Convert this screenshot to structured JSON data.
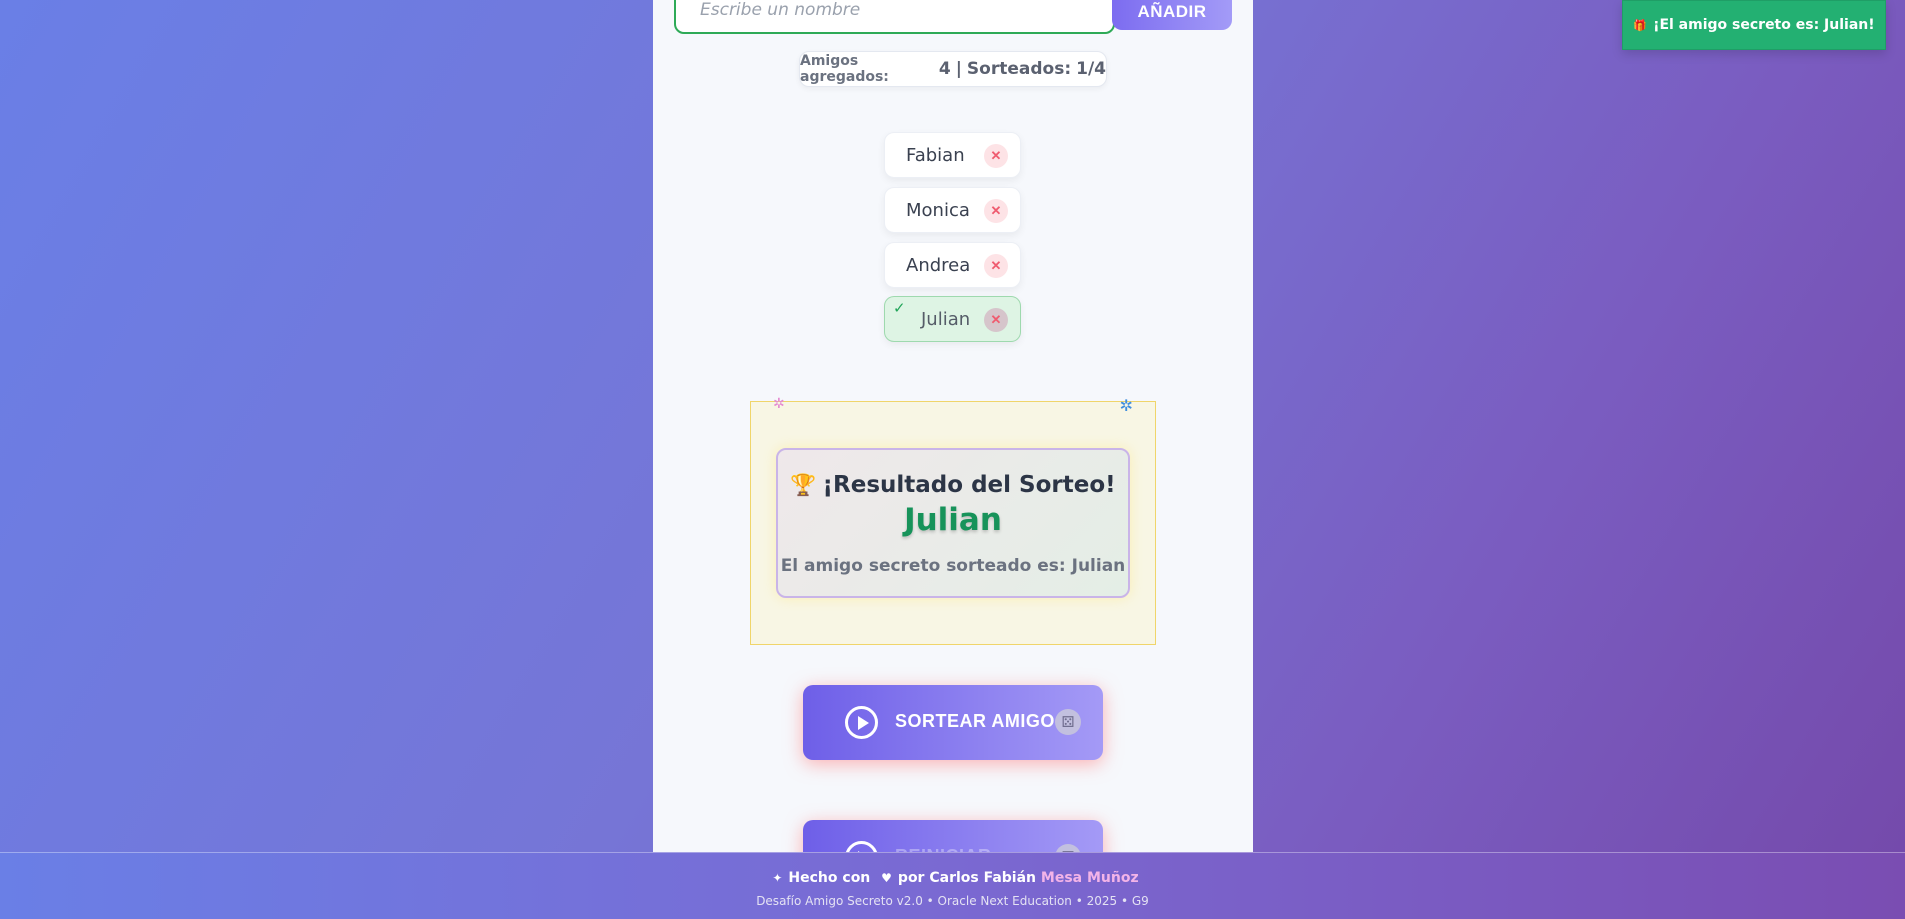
{
  "input": {
    "placeholder": "Escribe un nombre",
    "add_label": "AÑADIR"
  },
  "counter": {
    "added_label": "Amigos agregados:",
    "added_value": "4",
    "separator": "|",
    "drawn_label": "Sorteados:",
    "drawn_value": "1/4"
  },
  "friends": [
    {
      "name": "Fabian",
      "drawn": false
    },
    {
      "name": "Monica",
      "drawn": false
    },
    {
      "name": "Andrea",
      "drawn": false
    },
    {
      "name": "Julian",
      "drawn": true
    }
  ],
  "icons": {
    "remove": "close-icon",
    "check": "check-icon",
    "trophy": "trophy-icon",
    "play": "play-icon",
    "dice": "dice-icon"
  },
  "result": {
    "title": "¡Resultado del Sorteo!",
    "name": "Julian",
    "text": "El amigo secreto sorteado es: Julian"
  },
  "buttons": {
    "draw_label": "SORTEAR AMIGO",
    "reset_label": "REINICIAR"
  },
  "toast": {
    "text": "¡El amigo secreto es: Julian!"
  },
  "footer": {
    "made_with": "Hecho con",
    "by": "por",
    "author_first": "Carlos Fabián",
    "author_last": "Mesa Muñoz",
    "credits": "Desafío Amigo Secreto v2.0 • Oracle Next Education • 2025 • G9"
  },
  "colors": {
    "accent": "#7c6cf0",
    "success": "#23b072",
    "result_name": "#17935a",
    "remove": "#ef5b6f"
  }
}
